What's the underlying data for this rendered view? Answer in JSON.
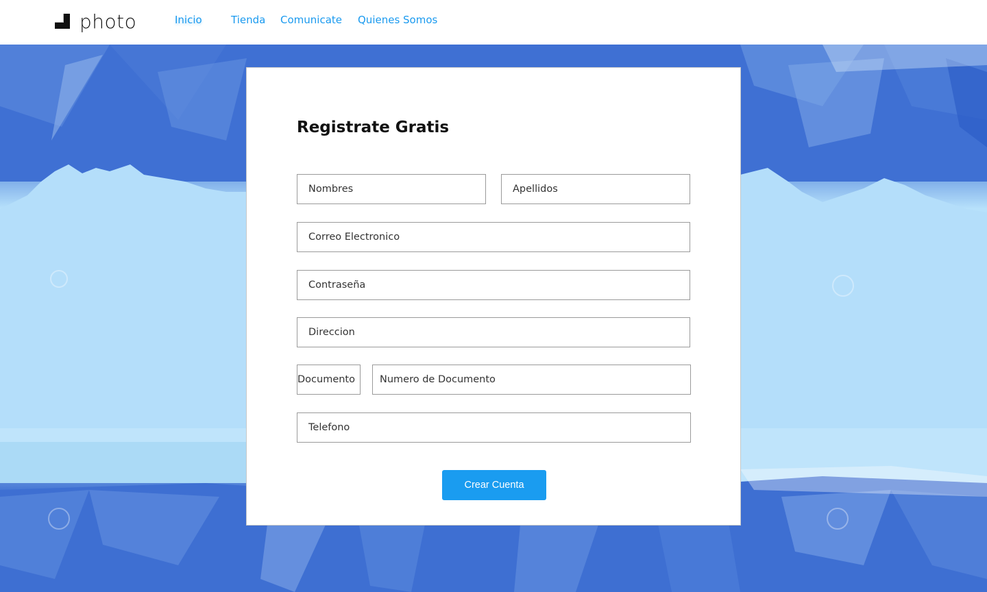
{
  "brand": {
    "name": "photo",
    "icon": "overlapping-squares-logo-icon"
  },
  "nav": {
    "items": [
      {
        "label": "Inicio",
        "active": true
      },
      {
        "label": "Tienda",
        "active": false
      },
      {
        "label": "Comunicate",
        "active": false
      },
      {
        "label": "Quienes Somos",
        "active": false
      }
    ]
  },
  "form": {
    "title": "Registrate Gratis",
    "fields": {
      "nombres": "Nombres",
      "apellidos": "Apellidos",
      "correo": "Correo Electronico",
      "contrasena": "Contraseña",
      "direccion": "Direccion",
      "documento": "Documento",
      "numero_documento": "Numero de Documento",
      "telefono": "Telefono"
    },
    "submit_label": "Crear Cuenta"
  },
  "colors": {
    "accent": "#1a9cf0",
    "nav_link": "#1a9aef",
    "background_dark_blue": "#3d6fd2",
    "background_light_blue": "#b7e1fb"
  }
}
